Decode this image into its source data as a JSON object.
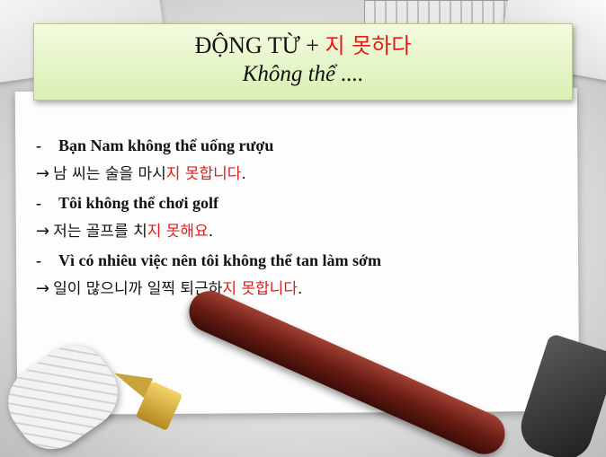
{
  "title": {
    "line1_prefix": "ĐỘNG TỪ + ",
    "line1_korean": "지 못하다",
    "line2": "Không thể ...."
  },
  "items": [
    {
      "dash": "-",
      "vietnamese": "Bạn Nam không thể uống rượu",
      "arrow": "→",
      "korean_black": "남 씨는 술을 마시",
      "korean_red": "지 못합니다",
      "korean_end": "."
    },
    {
      "dash": "-",
      "vietnamese": "Tôi không thể chơi golf",
      "arrow": "→",
      "korean_black": "저는 골프를 치",
      "korean_red": "지 못해요",
      "korean_end": "."
    },
    {
      "dash": "-",
      "vietnamese": "Vì có nhiêu việc nên tôi không thể tan làm sớm",
      "arrow": "→",
      "korean_black": "일이 많으니까 일찍 퇴근하",
      "korean_red": "지 못합니다",
      "korean_end": "."
    }
  ],
  "colors": {
    "accent_red": "#e21b1b",
    "title_box": "#d9f0b2"
  }
}
